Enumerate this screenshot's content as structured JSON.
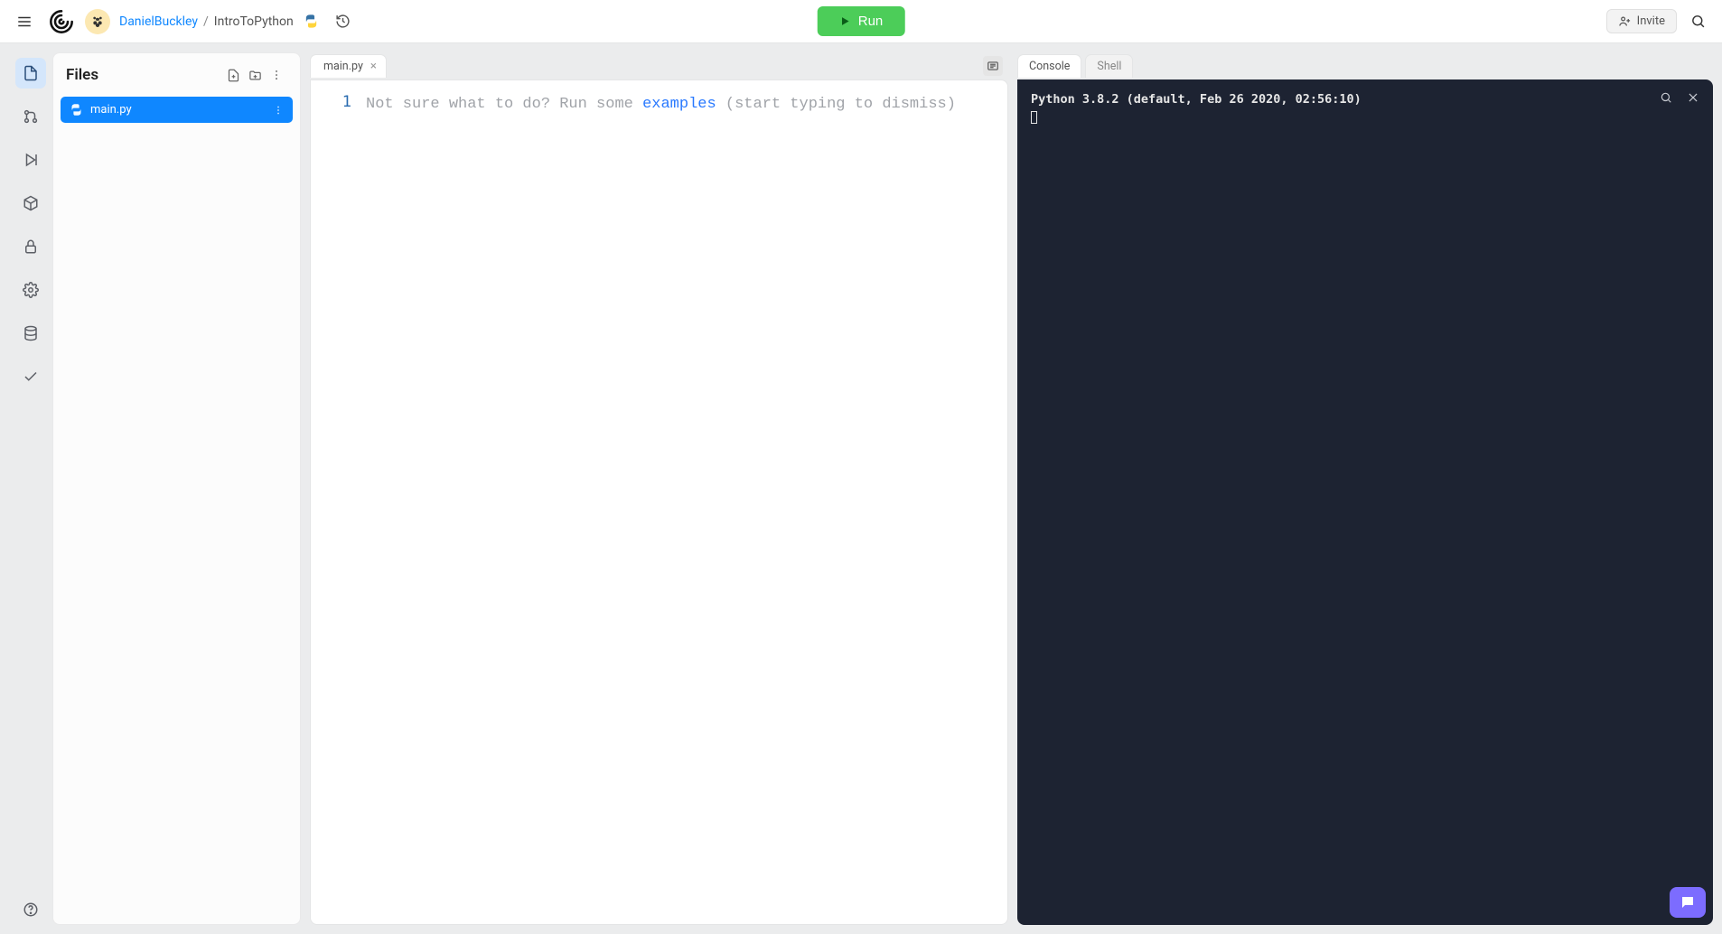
{
  "header": {
    "user": "DanielBuckley",
    "separator": "/",
    "repl": "IntroToPython",
    "run_label": "Run",
    "invite_label": "Invite"
  },
  "sidebar_rail": {
    "items": [
      "files",
      "version-control",
      "debugger",
      "packages",
      "secrets",
      "settings",
      "database",
      "checkmarks"
    ]
  },
  "files_panel": {
    "title": "Files",
    "items": [
      {
        "name": "main.py"
      }
    ]
  },
  "editor": {
    "tabs": [
      {
        "label": "main.py"
      }
    ],
    "gutter": [
      "1"
    ],
    "placeholder_pre": "Not sure what to do? Run some ",
    "placeholder_link": "examples",
    "placeholder_post": " (start typing to dismiss)"
  },
  "console": {
    "tabs": [
      {
        "label": "Console",
        "active": true
      },
      {
        "label": "Shell",
        "active": false
      }
    ],
    "output": "Python 3.8.2 (default, Feb 26 2020, 02:56:10)",
    "prompt": "⠀"
  }
}
